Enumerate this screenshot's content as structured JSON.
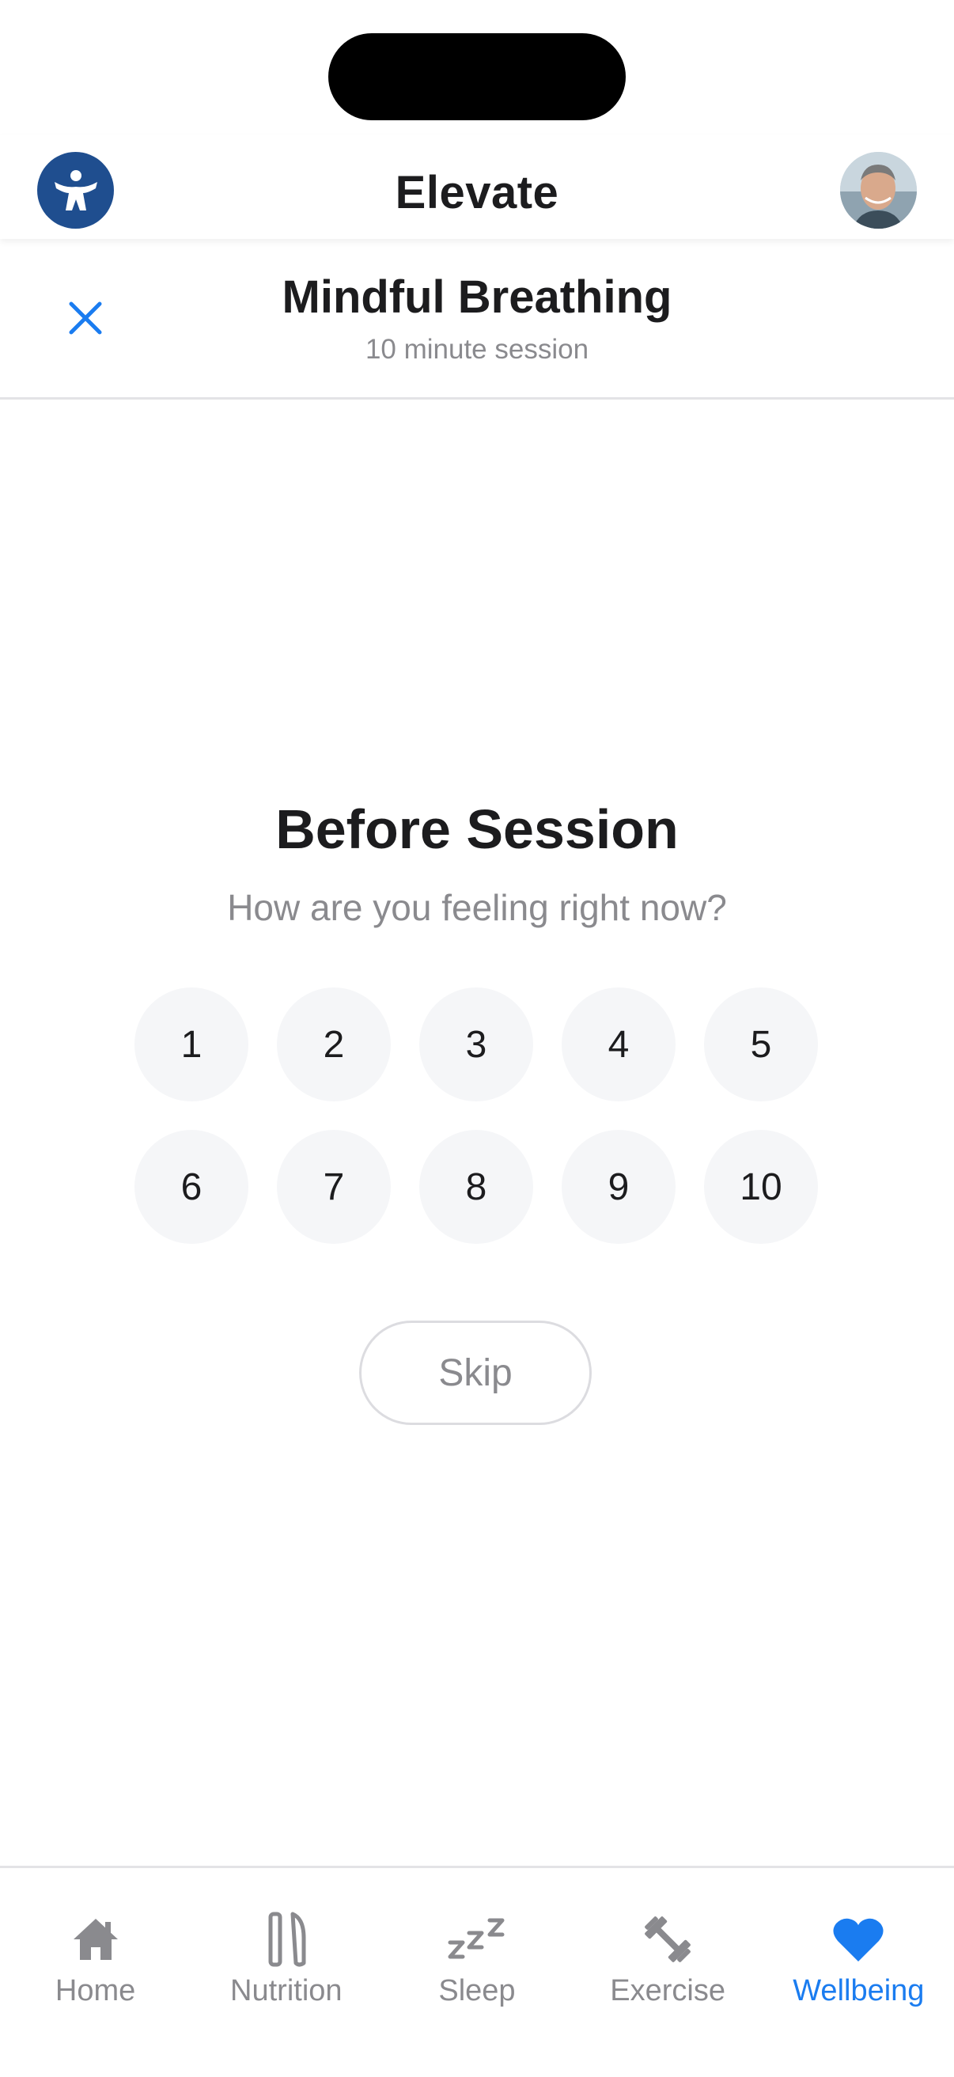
{
  "app": {
    "title": "Elevate"
  },
  "session": {
    "title": "Mindful Breathing",
    "subtitle": "10 minute session"
  },
  "rating": {
    "heading": "Before Session",
    "question": "How are you feeling right now?",
    "options": [
      "1",
      "2",
      "3",
      "4",
      "5",
      "6",
      "7",
      "8",
      "9",
      "10"
    ],
    "skip_label": "Skip"
  },
  "nav": {
    "items": [
      {
        "label": "Home",
        "icon": "home-icon"
      },
      {
        "label": "Nutrition",
        "icon": "nutrition-icon"
      },
      {
        "label": "Sleep",
        "icon": "sleep-icon"
      },
      {
        "label": "Exercise",
        "icon": "dumbbell-icon"
      },
      {
        "label": "Wellbeing",
        "icon": "heart-icon"
      }
    ],
    "active_index": 4
  },
  "colors": {
    "accent": "#1a7cf0",
    "logo_bg": "#1f4e8f",
    "muted_text": "#8a8a8e",
    "rating_bg": "#f5f6f8"
  }
}
